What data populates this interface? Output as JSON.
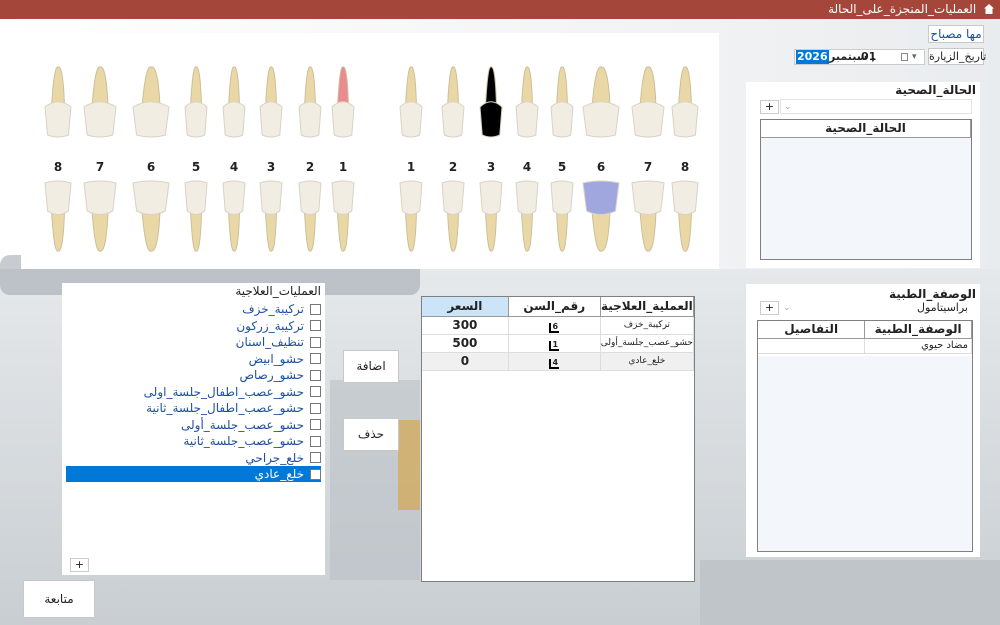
{
  "window": {
    "title": "العمليات_المنجزة_على_الحالة"
  },
  "patient": {
    "name_button": "مها مصباح"
  },
  "visit": {
    "date_label": "تاريخ_الزيارة",
    "date_value_day": "01",
    "date_value_month": "سبتمبر ,",
    "date_value_year": "2026"
  },
  "teeth": {
    "upper_numbers": [
      "8",
      "7",
      "6",
      "5",
      "4",
      "3",
      "2",
      "1",
      "1",
      "2",
      "3",
      "4",
      "5",
      "6",
      "7",
      "8"
    ]
  },
  "health": {
    "title": "الحالة_الصحية",
    "add_label": "+",
    "column_header": "الحالة_الصحية"
  },
  "prescription": {
    "title": "الوصفة_الطبية",
    "add_label": "+",
    "selected_drug": "براسيتامول",
    "columns": [
      "الوصفة_الطبية",
      "التفاصيل"
    ],
    "rows": [
      {
        "drug": "مضاد حيوي",
        "details": ""
      }
    ]
  },
  "operations": {
    "title": "العمليات_العلاجية",
    "items": [
      "تركيبة_خزف",
      "تركيبة_زركون",
      "تنظيف_اسنان",
      "حشو_ابيض",
      "حشو_رصاص",
      "حشو_عصب_اطفال_جلسة_اولى",
      "حشو_عصب_اطفال_جلسة_ثانية",
      "حشو_عصب_جلسة_أولى",
      "حشو_عصب_جلسة_ثانية",
      "خلع_جراحي",
      "خلع_عادي"
    ],
    "selected_index": 10,
    "add_label": "+"
  },
  "actions": {
    "add": "اضافة",
    "delete": "حذف",
    "continue": "متابعة"
  },
  "procedures": {
    "columns": [
      "العملية_العلاجية",
      "رقم_السن",
      "السعر"
    ],
    "rows": [
      {
        "operation": "تركيبة_خزف",
        "tooth": "6",
        "price": "300"
      },
      {
        "operation": "حشو_عصب_جلسة_أولى",
        "tooth": "1",
        "price": "500"
      },
      {
        "operation": "خلع_عادي",
        "tooth": "4",
        "price": "0"
      }
    ]
  },
  "colors": {
    "titlebar": "#a5463a",
    "selection": "#0078d7",
    "link_text": "#1f4fa0"
  }
}
